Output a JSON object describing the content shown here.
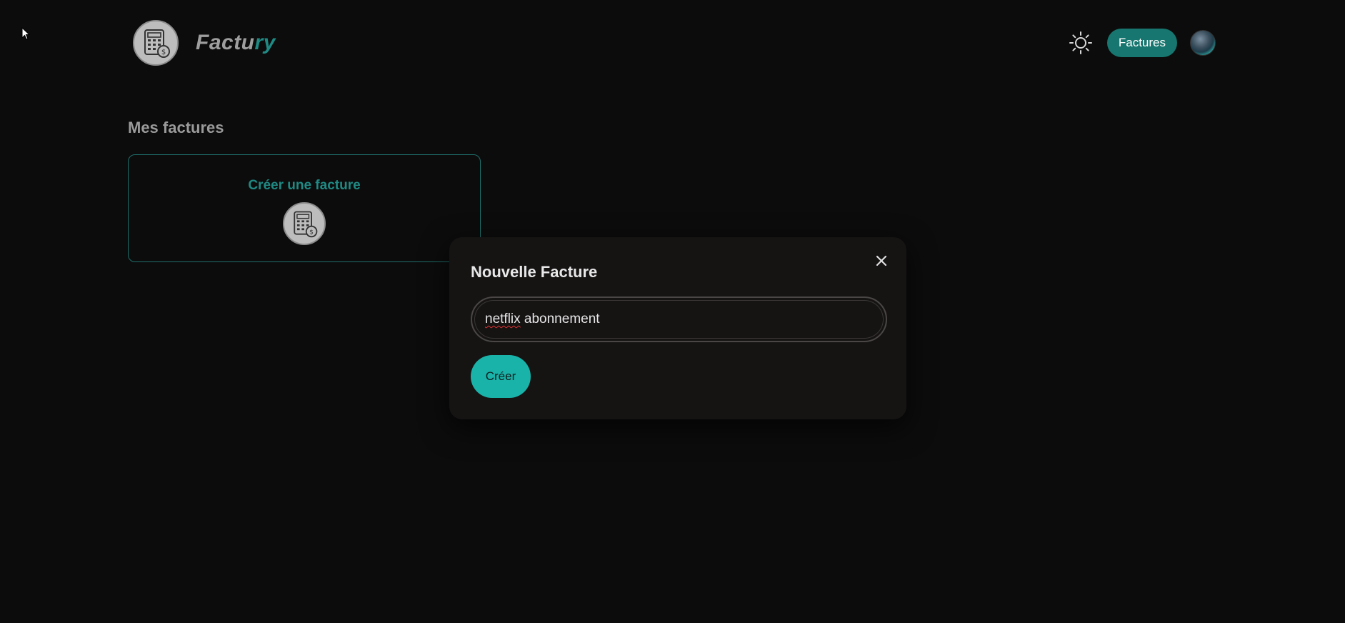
{
  "header": {
    "brand_part1": "Factu",
    "brand_part2": "ry",
    "logo_icon": "calculator-dollar-icon",
    "theme_icon": "sun-icon",
    "nav_button": "Factures",
    "avatar_icon": "user-avatar"
  },
  "main": {
    "section_title": "Mes factures",
    "create_card_label": "Créer une facture",
    "create_card_icon": "calculator-dollar-icon"
  },
  "modal": {
    "title": "Nouvelle Facture",
    "close_icon": "close-icon",
    "input_value_misspelled": "netflix",
    "input_value_rest": " abonnement",
    "submit_label": "Créer"
  },
  "colors": {
    "background": "#0c0c0c",
    "accent": "#1ab3aa",
    "accent_dark": "#17766f",
    "modal_bg": "#161313"
  }
}
